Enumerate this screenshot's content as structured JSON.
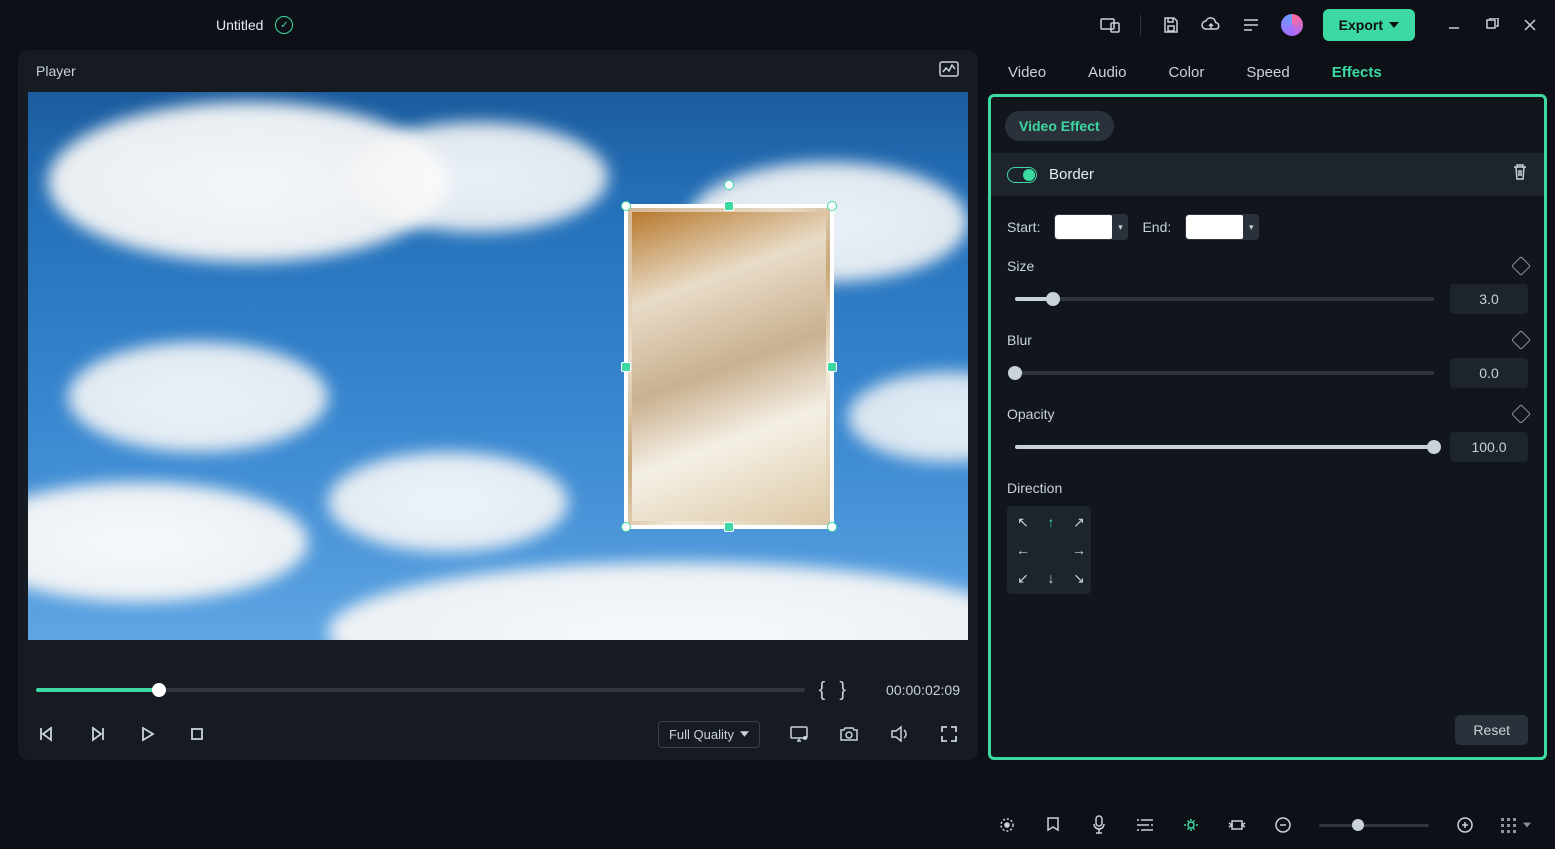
{
  "topbar": {
    "title": "Untitled",
    "export_label": "Export"
  },
  "player": {
    "header": "Player",
    "timecode": "00:00:02:09",
    "quality_label": "Full Quality"
  },
  "right_tabs": {
    "items": [
      {
        "label": "Video"
      },
      {
        "label": "Audio"
      },
      {
        "label": "Color"
      },
      {
        "label": "Speed"
      },
      {
        "label": "Effects"
      }
    ]
  },
  "effects": {
    "chip": "Video Effect",
    "section_label": "Border",
    "start_label": "Start:",
    "end_label": "End:",
    "size": {
      "label": "Size",
      "value": "3.0",
      "pct": 9
    },
    "blur": {
      "label": "Blur",
      "value": "0.0",
      "pct": 0
    },
    "opacity": {
      "label": "Opacity",
      "value": "100.0",
      "pct": 100
    },
    "direction_label": "Direction",
    "reset_label": "Reset"
  }
}
